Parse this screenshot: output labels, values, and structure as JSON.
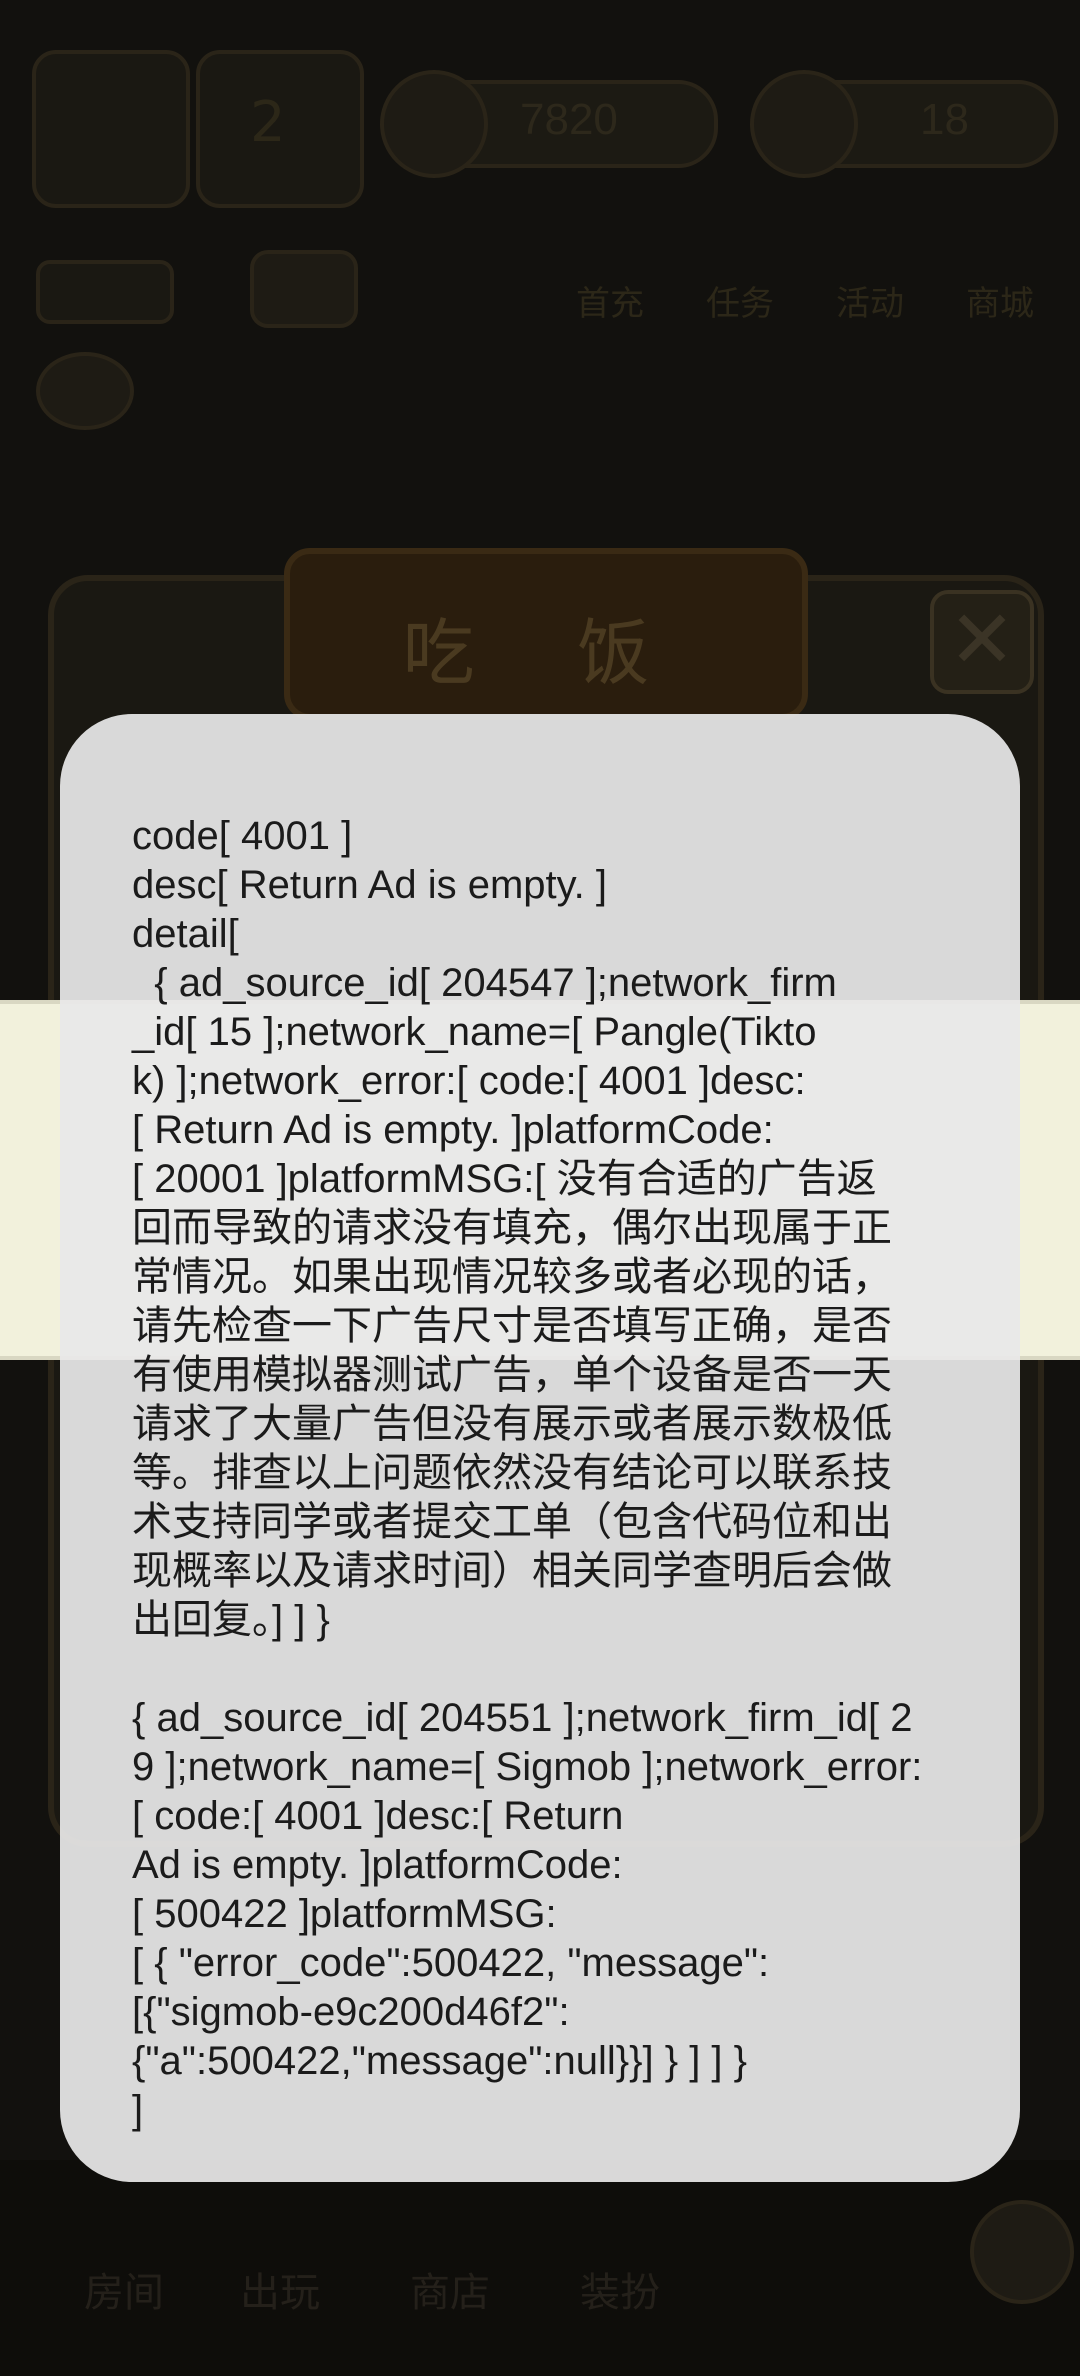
{
  "background": {
    "level_value": "2",
    "hearts_value": "7820",
    "gems_value": "18",
    "menu_items": [
      "首充",
      "任务",
      "活动",
      "商城"
    ],
    "dialog_title": "吃 饭",
    "bottom_nav": [
      "房间",
      "出玩",
      "商店",
      "装扮"
    ]
  },
  "dialog": {
    "message": "code[ 4001 ]\ndesc[ Return Ad is empty. ]\ndetail[\n  { ad_source_id[ 204547 ];network_firm\n_id[ 15 ];network_name=[ Pangle(Tikto\nk) ];network_error:[ code:[ 4001 ]desc:\n[ Return Ad is empty. ]platformCode:\n[ 20001 ]platformMSG:[ 没有合适的广告返\n回而导致的请求没有填充，偶尔出现属于正\n常情况。如果出现情况较多或者必现的话，\n请先检查一下广告尺寸是否填写正确，是否\n有使用模拟器测试广告，单个设备是否一天\n请求了大量广告但没有展示或者展示数极低\n等。排查以上问题依然没有结论可以联系技\n术支持同学或者提交工单（包含代码位和出\n现概率以及请求时间）相关同学查明后会做\n出回复。] ] }\n\n{ ad_source_id[ 204551 ];network_firm_id[ 2\n9 ];network_name=[ Sigmob ];network_error:\n[ code:[ 4001 ]desc:[ Return\nAd is empty. ]platformCode:\n[ 500422 ]platformMSG:\n[ { \"error_code\":500422, \"message\":\n[{\"sigmob-e9c200d46f2\":\n{\"a\":500422,\"message\":null}}] } ] ] }\n]"
  }
}
